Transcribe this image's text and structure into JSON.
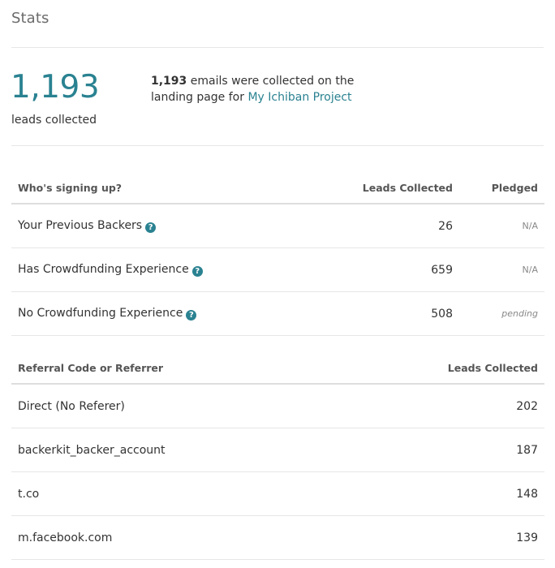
{
  "page": {
    "title": "Stats"
  },
  "summary": {
    "leads_count": "1,193",
    "leads_label": "leads collected",
    "desc_count": "1,193",
    "desc_text": " emails were collected on the landing page for ",
    "project_link": "My Ichiban Project"
  },
  "signups_table": {
    "headers": {
      "name": "Who's signing up?",
      "leads": "Leads Collected",
      "pledged": "Pledged"
    },
    "rows": [
      {
        "name": "Your Previous Backers",
        "leads": "26",
        "pledged": "N/A",
        "help_icon": "question-circle-icon"
      },
      {
        "name": "Has Crowdfunding Experience",
        "leads": "659",
        "pledged": "N/A",
        "help_icon": "question-circle-icon"
      },
      {
        "name": "No Crowdfunding Experience",
        "leads": "508",
        "pledged": "pending",
        "help_icon": "question-circle-icon"
      }
    ]
  },
  "referrer_table": {
    "headers": {
      "name": "Referral Code or Referrer",
      "leads": "Leads Collected"
    },
    "rows": [
      {
        "name": "Direct (No Referer)",
        "leads": "202"
      },
      {
        "name": "backerkit_backer_account",
        "leads": "187"
      },
      {
        "name": "t.co",
        "leads": "148"
      },
      {
        "name": "m.facebook.com",
        "leads": "139"
      }
    ]
  },
  "colors": {
    "accent": "#2a8291",
    "divider": "#e6e6e6",
    "muted": "#888888"
  }
}
